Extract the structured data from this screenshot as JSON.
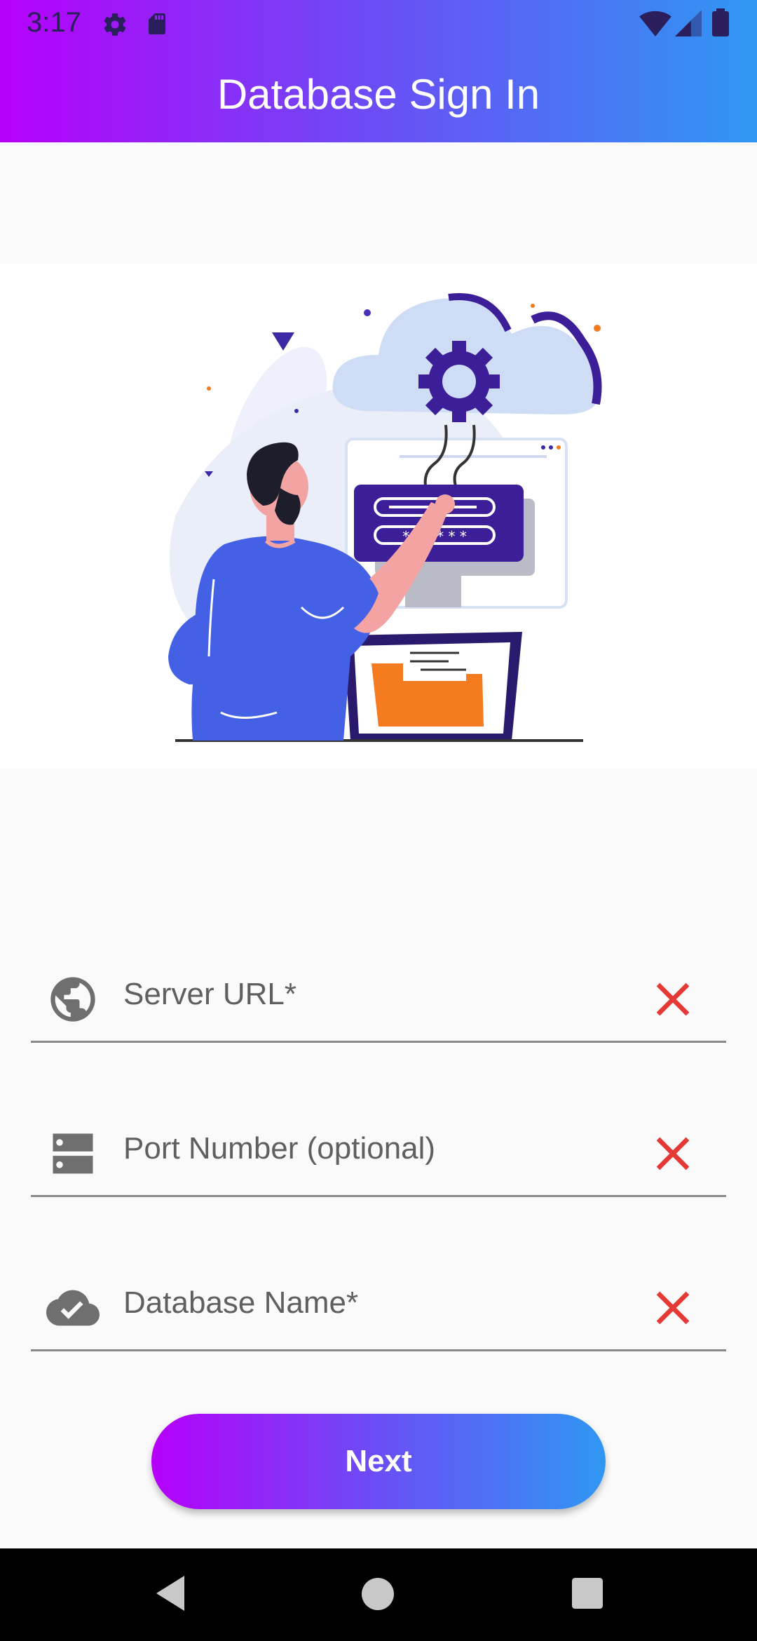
{
  "status_bar": {
    "time": "3:17"
  },
  "app_bar": {
    "title": "Database Sign In"
  },
  "form": {
    "fields": [
      {
        "label": "Server URL*",
        "icon": "globe-icon"
      },
      {
        "label": "Port Number (optional)",
        "icon": "server-icon"
      },
      {
        "label": "Database Name*",
        "icon": "cloud-done-icon"
      }
    ],
    "next_label": "Next"
  },
  "colors": {
    "gradient_start": "#b600fa",
    "gradient_end": "#2f97f3",
    "clear_icon": "#e53935"
  }
}
